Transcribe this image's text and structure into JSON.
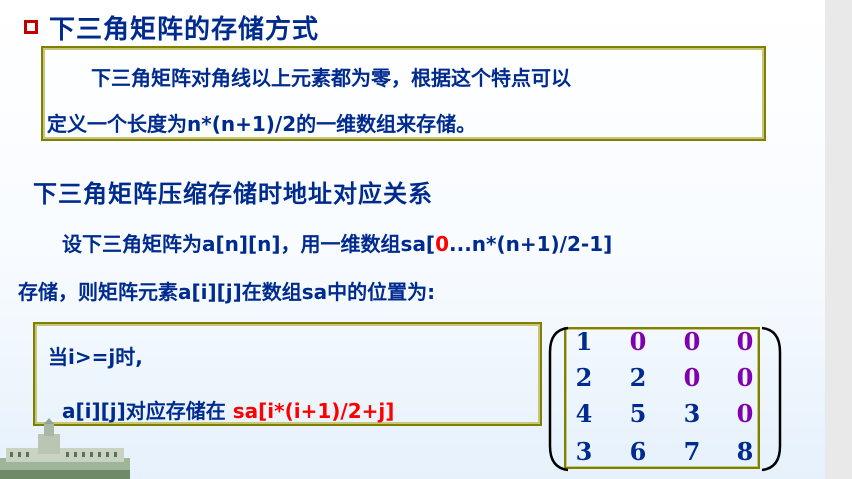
{
  "slide": {
    "title": "下三角矩阵的存储方式",
    "definition_lines": [
      "下三角矩阵对角线以上元素都为零，根据这个特点可以",
      "定义一个长度为n*(n+1)/2的一维数组来存储。"
    ],
    "section_title": "下三角矩阵压缩存储时地址对应关系",
    "para_line1_before": "设下三角矩阵为a[n][n]，用一维数组sa[",
    "para_line1_red": "0",
    "para_line1_after": "...n*(n+1)/2-1]",
    "para_line2": "存储，则矩阵元素a[i][j]在数组sa中的位置为:",
    "condition": "当i>=j时,",
    "mapping_prefix": "a[i][j]对应存储在 ",
    "mapping_formula": "sa[i*(i+1)/2+j]"
  },
  "matrix": {
    "rows": [
      [
        "1",
        "0",
        "0",
        "0"
      ],
      [
        "2",
        "2",
        "0",
        "0"
      ],
      [
        "4",
        "5",
        "3",
        "0"
      ],
      [
        "3",
        "6",
        "7",
        "8"
      ]
    ],
    "colors": {
      "lower": "#002b8e",
      "upper_zero": "#8000b0"
    }
  },
  "colors": {
    "text": "#002b8e",
    "accent": "#ff0000",
    "bullet": "#c00000",
    "frame": "#7f7f00"
  }
}
